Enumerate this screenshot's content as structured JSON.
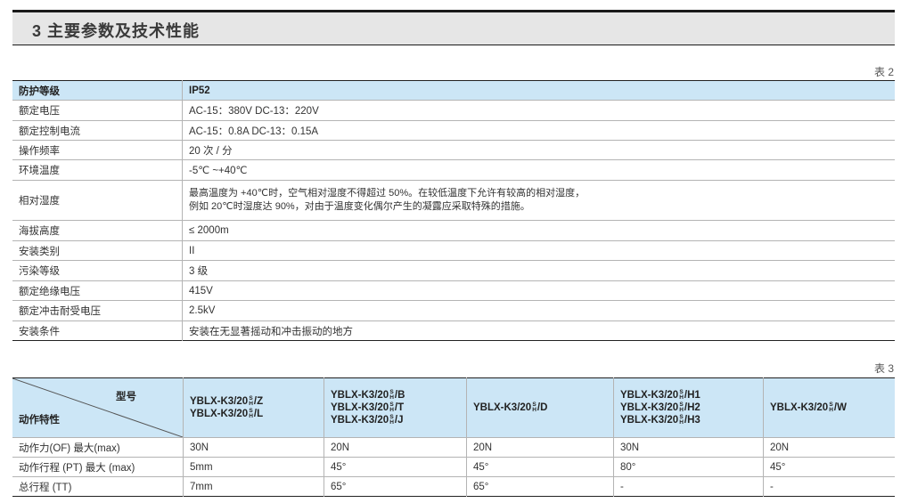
{
  "section": {
    "title": "3 主要参数及技术性能"
  },
  "table2": {
    "caption": "表 2",
    "rows": [
      {
        "param": "防护等级",
        "value": "IP52"
      },
      {
        "param": "额定电压",
        "value": "AC-15：380V  DC-13：220V"
      },
      {
        "param": "额定控制电流",
        "value": "AC-15：0.8A  DC-13：0.15A"
      },
      {
        "param": "操作频率",
        "value": "20 次 / 分"
      },
      {
        "param": "环境温度",
        "value": "-5℃ ~+40℃"
      },
      {
        "param": "相对湿度",
        "value": "最高温度为 +40℃时，空气相对湿度不得超过 50%。在较低温度下允许有较高的相对湿度，",
        "value2": "例如 20℃时湿度达 90%，对由于温度变化偶尔产生的凝露应采取特殊的措施。"
      },
      {
        "param": "海拔高度",
        "value": "≤ 2000m"
      },
      {
        "param": "安装类别",
        "value": "II"
      },
      {
        "param": "污染等级",
        "value": "3 级"
      },
      {
        "param": "额定绝缘电压",
        "value": "415V"
      },
      {
        "param": "额定冲击耐受电压",
        "value": "2.5kV"
      },
      {
        "param": "安装条件",
        "value": "安装在无显著摇动和冲击振动的地方"
      }
    ]
  },
  "table3": {
    "caption": "表 3",
    "header_top": "型号",
    "header_bottom": "动作特性",
    "frac_top": "S",
    "frac_bottom": "H",
    "model_prefix": "YBLX-K3/20",
    "models": [
      [
        "/Z",
        "/L"
      ],
      [
        "/B",
        "/T",
        "/J"
      ],
      [
        "/D"
      ],
      [
        "/H1",
        "/H2",
        "/H3"
      ],
      [
        "/W"
      ]
    ],
    "rows": [
      {
        "label": "动作力(OF) 最大(max)",
        "values": [
          "30N",
          "20N",
          "20N",
          "30N",
          "20N"
        ]
      },
      {
        "label": "动作行程 (PT) 最大 (max)",
        "values": [
          "5mm",
          "45°",
          "45°",
          "80°",
          "45°"
        ]
      },
      {
        "label": "总行程 (TT)",
        "values": [
          "7mm",
          "65°",
          "65°",
          "-",
          "-"
        ]
      }
    ]
  }
}
